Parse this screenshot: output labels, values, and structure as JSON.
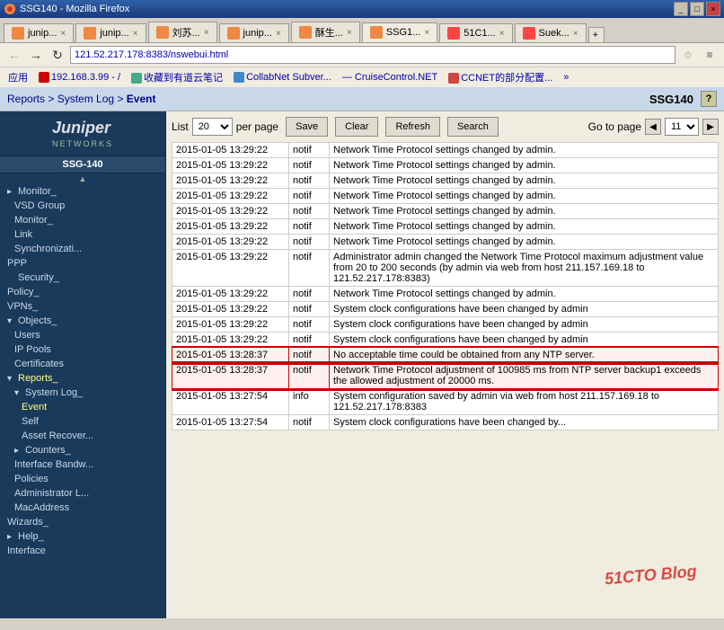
{
  "window": {
    "title": "SSG140 - Mozilla Firefox",
    "controls": [
      "_",
      "□",
      "×"
    ]
  },
  "tabs": [
    {
      "label": "junip...",
      "icon_color": "#e84",
      "active": false
    },
    {
      "label": "junip...",
      "icon_color": "#e84",
      "active": false
    },
    {
      "label": "刘苏...",
      "icon_color": "#e84",
      "active": false
    },
    {
      "label": "junip...",
      "icon_color": "#e84",
      "active": false
    },
    {
      "label": "酥生...",
      "icon_color": "#e84",
      "active": false
    },
    {
      "label": "SSG1...",
      "icon_color": "#e84",
      "active": true
    },
    {
      "label": "51C1...",
      "icon_color": "#f44",
      "active": false
    },
    {
      "label": "Suek...",
      "icon_color": "#f44",
      "active": false
    }
  ],
  "address_bar": {
    "url": "121.52.217.178:8383/nswebui.html",
    "url_display": "121.52.217.178:8383/nswebui.html"
  },
  "bookmarks": [
    {
      "label": "应用",
      "has_icon": false
    },
    {
      "label": "192.168.3.99 - /",
      "has_icon": true
    },
    {
      "label": "收藏到有道云笔记",
      "has_icon": true
    },
    {
      "label": "CollabNet Subver...",
      "has_icon": true
    },
    {
      "label": "CruiseControl.NET",
      "has_icon": true
    },
    {
      "label": "CCNET的部分配置...",
      "has_icon": true
    }
  ],
  "page_header": {
    "breadcrumb": [
      "Reports",
      "System Log",
      "Event"
    ],
    "device_name": "SSG140"
  },
  "sidebar": {
    "device": "SSG-140",
    "items": [
      {
        "label": "Monitor_",
        "level": 1,
        "expanded": false,
        "indent": 1
      },
      {
        "label": "VSD Group_",
        "level": 2,
        "expanded": false,
        "indent": 2
      },
      {
        "label": "Monitor_",
        "level": 2,
        "expanded": false,
        "indent": 2
      },
      {
        "label": "Link",
        "level": 2,
        "indent": 2
      },
      {
        "label": "Synchronizati...",
        "level": 2,
        "indent": 2
      },
      {
        "label": "PPP",
        "level": 1,
        "indent": 1
      },
      {
        "label": "Security_",
        "level": 0,
        "indent": 0,
        "active": false
      },
      {
        "label": "Policy_",
        "level": 0,
        "indent": 0
      },
      {
        "label": "VPNs_",
        "level": 0,
        "indent": 0
      },
      {
        "label": "Objects_",
        "level": 0,
        "indent": 0,
        "expanded": true
      },
      {
        "label": "Users",
        "level": 1,
        "indent": 1
      },
      {
        "label": "IP Pools",
        "level": 1,
        "indent": 1
      },
      {
        "label": "Certificates",
        "level": 1,
        "indent": 1
      },
      {
        "label": "Reports_",
        "level": 0,
        "indent": 0,
        "expanded": true,
        "active": true
      },
      {
        "label": "System Log_",
        "level": 1,
        "indent": 1,
        "expanded": true
      },
      {
        "label": "Event",
        "level": 2,
        "indent": 2,
        "active": true
      },
      {
        "label": "Self",
        "level": 2,
        "indent": 2
      },
      {
        "label": "Asset Recover...",
        "level": 2,
        "indent": 2
      },
      {
        "label": "Counters_",
        "level": 1,
        "indent": 1
      },
      {
        "label": "Interface Bandw...",
        "level": 1,
        "indent": 1
      },
      {
        "label": "Policies",
        "level": 1,
        "indent": 1
      },
      {
        "label": "Administrator L...",
        "level": 1,
        "indent": 1
      },
      {
        "label": "MacAddress",
        "level": 1,
        "indent": 1
      },
      {
        "label": "Wizards_",
        "level": 0,
        "indent": 0
      },
      {
        "label": "Help_",
        "level": 0,
        "indent": 0
      }
    ]
  },
  "controls": {
    "list_label": "List",
    "list_value": "20",
    "per_page_label": "per page",
    "goto_label": "Go to page",
    "page_value": "11",
    "save_label": "Save",
    "clear_label": "Clear",
    "refresh_label": "Refresh",
    "search_label": "Search"
  },
  "table": {
    "headers": [
      "",
      "",
      "",
      ""
    ],
    "rows": [
      {
        "date": "2015-01-05 13:29:22",
        "level": "notif",
        "message": "Network Time Protocol settings changed by admin.",
        "highlight": false
      },
      {
        "date": "2015-01-05 13:29:22",
        "level": "notif",
        "message": "Network Time Protocol settings changed by admin.",
        "highlight": false
      },
      {
        "date": "2015-01-05 13:29:22",
        "level": "notif",
        "message": "Network Time Protocol settings changed by admin.",
        "highlight": false
      },
      {
        "date": "2015-01-05 13:29:22",
        "level": "notif",
        "message": "Network Time Protocol settings changed by admin.",
        "highlight": false
      },
      {
        "date": "2015-01-05 13:29:22",
        "level": "notif",
        "message": "Network Time Protocol settings changed by admin.",
        "highlight": false
      },
      {
        "date": "2015-01-05 13:29:22",
        "level": "notif",
        "message": "Network Time Protocol settings changed by admin.",
        "highlight": false
      },
      {
        "date": "2015-01-05 13:29:22",
        "level": "notif",
        "message": "Network Time Protocol settings changed by admin.",
        "highlight": false
      },
      {
        "date": "2015-01-05 13:29:22",
        "level": "notif",
        "message": "Administrator admin changed the Network Time Protocol maximum adjustment value from 20 to 200 seconds (by admin via web from host 211.157.169.18 to 121.52.217.178:8383)",
        "highlight": false
      },
      {
        "date": "2015-01-05 13:29:22",
        "level": "notif",
        "message": "Network Time Protocol settings changed by admin.",
        "highlight": false
      },
      {
        "date": "2015-01-05 13:29:22",
        "level": "notif",
        "message": "System clock configurations have been changed by admin",
        "highlight": false
      },
      {
        "date": "2015-01-05 13:29:22",
        "level": "notif",
        "message": "System clock configurations have been changed by admin",
        "highlight": false
      },
      {
        "date": "2015-01-05 13:29:22",
        "level": "notif",
        "message": "System clock configurations have been changed by admin",
        "highlight": false
      },
      {
        "date": "2015-01-05 13:28:37",
        "level": "notif",
        "message": "No acceptable time could be obtained from any NTP server.",
        "highlight": true
      },
      {
        "date": "2015-01-05 13:28:37",
        "level": "notif",
        "message": "Network Time Protocol adjustment of 100985 ms from NTP server backup1 exceeds the allowed adjustment of 20000 ms.",
        "highlight": true
      },
      {
        "date": "2015-01-05 13:27:54",
        "level": "info",
        "message": "System configuration saved by admin via web from host 211.157.169.18 to 121.52.217.178:8383",
        "highlight": false
      },
      {
        "date": "2015-01-05 13:27:54",
        "level": "notif",
        "message": "System clock configurations have been changed by...",
        "highlight": false
      }
    ]
  },
  "watermark": "51CTO Blog"
}
